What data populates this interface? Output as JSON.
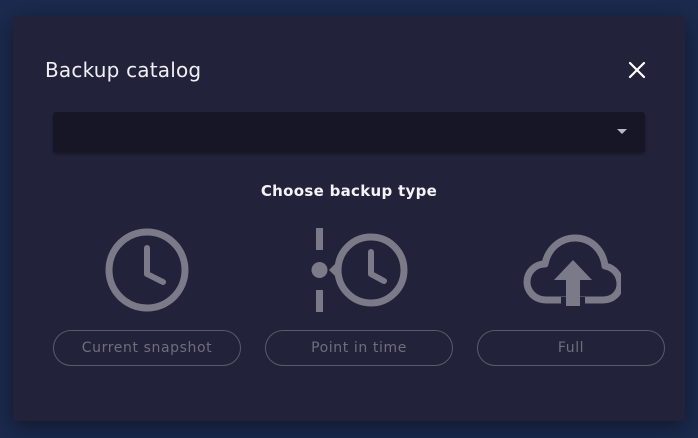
{
  "dialog": {
    "title": "Backup catalog",
    "close_icon": "close-icon",
    "select": {
      "value": "",
      "icon": "caret-down-icon"
    },
    "subtitle": "Choose backup type",
    "options": [
      {
        "label": "Current snapshot",
        "icon": "clock-icon"
      },
      {
        "label": "Point in time",
        "icon": "history-clock-icon"
      },
      {
        "label": "Full",
        "icon": "cloud-upload-icon"
      }
    ]
  },
  "colors": {
    "backdrop": "#1b2a4e",
    "dialog_bg": "#22223a",
    "select_bg": "#161627",
    "icon_gray": "#7a7a88",
    "disabled_text": "#6e6e80"
  }
}
